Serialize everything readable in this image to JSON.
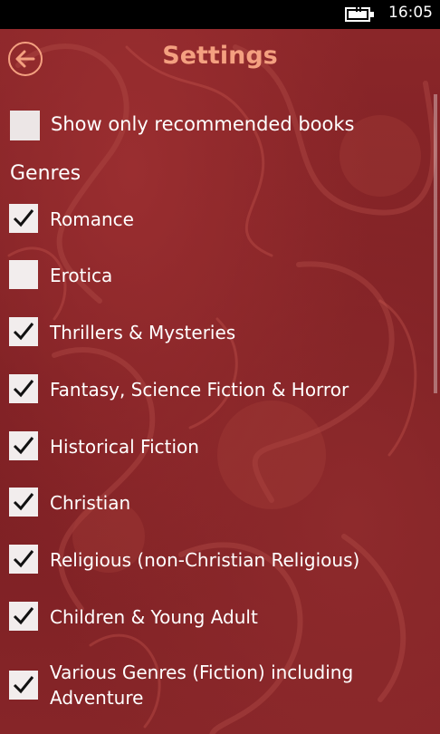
{
  "status_bar": {
    "time": "16:05",
    "battery_icon": "battery-charging-icon"
  },
  "header": {
    "title": "Settings",
    "back_icon": "arrow-left-icon"
  },
  "recommended": {
    "label": "Show only recommended books",
    "checked": false
  },
  "genres": {
    "heading": "Genres",
    "items": [
      {
        "label": "Romance",
        "checked": true
      },
      {
        "label": "Erotica",
        "checked": false
      },
      {
        "label": "Thrillers & Mysteries",
        "checked": true
      },
      {
        "label": "Fantasy, Science Fiction & Horror",
        "checked": true
      },
      {
        "label": "Historical Fiction",
        "checked": true
      },
      {
        "label": "Christian",
        "checked": true
      },
      {
        "label": "Religious (non-Christian Religious)",
        "checked": true
      },
      {
        "label": "Children & Young Adult",
        "checked": true
      },
      {
        "label": "Various Genres (Fiction) including Adventure",
        "checked": true
      }
    ]
  },
  "colors": {
    "accent": "#f4a080",
    "background": "#7d1f24",
    "checkbox_fill": "#f2eded"
  }
}
